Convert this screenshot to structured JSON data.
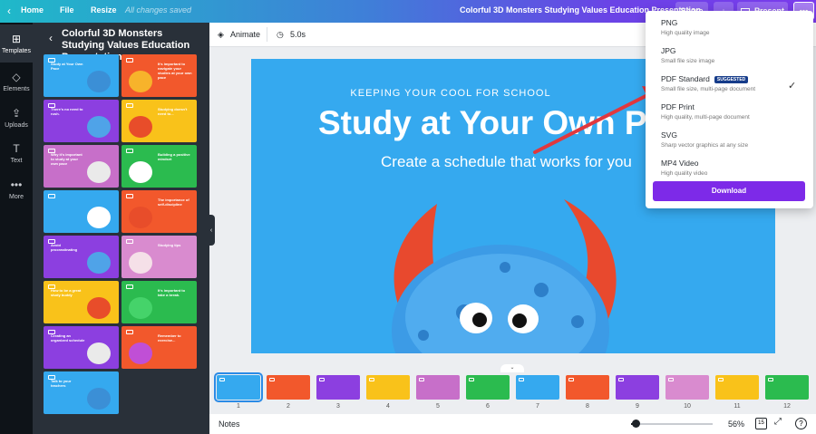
{
  "topbar": {
    "back": "‹",
    "home": "Home",
    "file": "File",
    "resize": "Resize",
    "saved": "All changes saved",
    "doc_title": "Colorful 3D Monsters Studying Values Education Presentation",
    "share": "Share",
    "download_icon": "↓",
    "present": "Present",
    "more": "•••"
  },
  "rail": [
    {
      "icon": "⊞",
      "label": "Templates"
    },
    {
      "icon": "◇",
      "label": "Elements"
    },
    {
      "icon": "⇪",
      "label": "Uploads"
    },
    {
      "icon": "T",
      "label": "Text"
    },
    {
      "icon": "•••",
      "label": "More"
    }
  ],
  "panel": {
    "title": "Colorful 3D Monsters Studying Values Education Presentation",
    "back": "‹",
    "thumbs": [
      {
        "text": "Study at Your Own Pace",
        "color": "#35a9ef",
        "blob": "#3b8fd6"
      },
      {
        "text": "It's important to navigate your studies at your own pace",
        "color": "#f2582c",
        "blob": "#f7b32b"
      },
      {
        "text": "There's no need to rush.",
        "color": "#8c3fe0",
        "blob": "#4fa3e8"
      },
      {
        "text": "Studying doesn't need to...",
        "color": "#f9c21a",
        "blob": "#e84d2a"
      },
      {
        "text": "Why it's important to study at your own pace",
        "color": "#c76fc9",
        "blob": "#eaeaea"
      },
      {
        "text": "Building a positive mindset",
        "color": "#2bbb4f",
        "blob": "#ffffff"
      },
      {
        "text": "",
        "color": "#35a9ef",
        "blob": "#ffffff"
      },
      {
        "text": "The importance of self-discipline",
        "color": "#f2582c",
        "blob": "#e84d2a"
      },
      {
        "text": "Avoid procrastinating",
        "color": "#8c3fe0",
        "blob": "#4fa3e8"
      },
      {
        "text": "Studying tips",
        "color": "#d98bcf",
        "blob": "#f5e0e8"
      },
      {
        "text": "How to be a great study buddy",
        "color": "#f9c21a",
        "blob": "#e84d2a"
      },
      {
        "text": "It's important to take a break.",
        "color": "#2bbb4f",
        "blob": "#45d36a"
      },
      {
        "text": "Creating an organized schedule",
        "color": "#8c3fe0",
        "blob": "#eaeaea"
      },
      {
        "text": "Remember to exercise...",
        "color": "#f2582c",
        "blob": "#c04fd6"
      },
      {
        "text": "Talk to your teachers",
        "color": "#35a9ef",
        "blob": "#3b8fd6"
      }
    ]
  },
  "toolbar": {
    "animate_icon": "◈",
    "animate": "Animate",
    "timer_icon": "◷",
    "duration": "5.0s"
  },
  "slide": {
    "kicker": "KEEPING YOUR COOL FOR SCHOOL",
    "title": "Study at Your Own P",
    "subtitle": "Create a schedule that works for you"
  },
  "strip": {
    "pager": "⌄",
    "pages": [
      {
        "num": "1",
        "color": "#35a9ef"
      },
      {
        "num": "2",
        "color": "#f2582c"
      },
      {
        "num": "3",
        "color": "#8c3fe0"
      },
      {
        "num": "4",
        "color": "#f9c21a"
      },
      {
        "num": "5",
        "color": "#c76fc9"
      },
      {
        "num": "6",
        "color": "#2bbb4f"
      },
      {
        "num": "7",
        "color": "#35a9ef"
      },
      {
        "num": "8",
        "color": "#f2582c"
      },
      {
        "num": "9",
        "color": "#8c3fe0"
      },
      {
        "num": "10",
        "color": "#d98bcf"
      },
      {
        "num": "11",
        "color": "#f9c21a"
      },
      {
        "num": "12",
        "color": "#2bbb4f"
      }
    ]
  },
  "bottombar": {
    "notes": "Notes",
    "zoom": "56%",
    "zoom_fraction": 0.05,
    "pages_count": "15"
  },
  "dropdown": {
    "options": [
      {
        "name": "PNG",
        "desc": "High quality image",
        "badge": "",
        "checked": ""
      },
      {
        "name": "JPG",
        "desc": "Small file size image",
        "badge": "",
        "checked": ""
      },
      {
        "name": "PDF Standard",
        "desc": "Small file size, multi-page document",
        "badge": "SUGGESTED",
        "checked": "✓"
      },
      {
        "name": "PDF Print",
        "desc": "High quality, multi-page document",
        "badge": "",
        "checked": ""
      },
      {
        "name": "SVG",
        "desc": "Sharp vector graphics at any size",
        "badge": "",
        "checked": ""
      },
      {
        "name": "MP4 Video",
        "desc": "High quality video",
        "badge": "",
        "checked": ""
      }
    ],
    "download": "Download",
    "close": "✕"
  },
  "colors": {
    "accent": "#7d2ae8",
    "slide_bg": "#35a9ef",
    "arrow": "#e0383e"
  }
}
